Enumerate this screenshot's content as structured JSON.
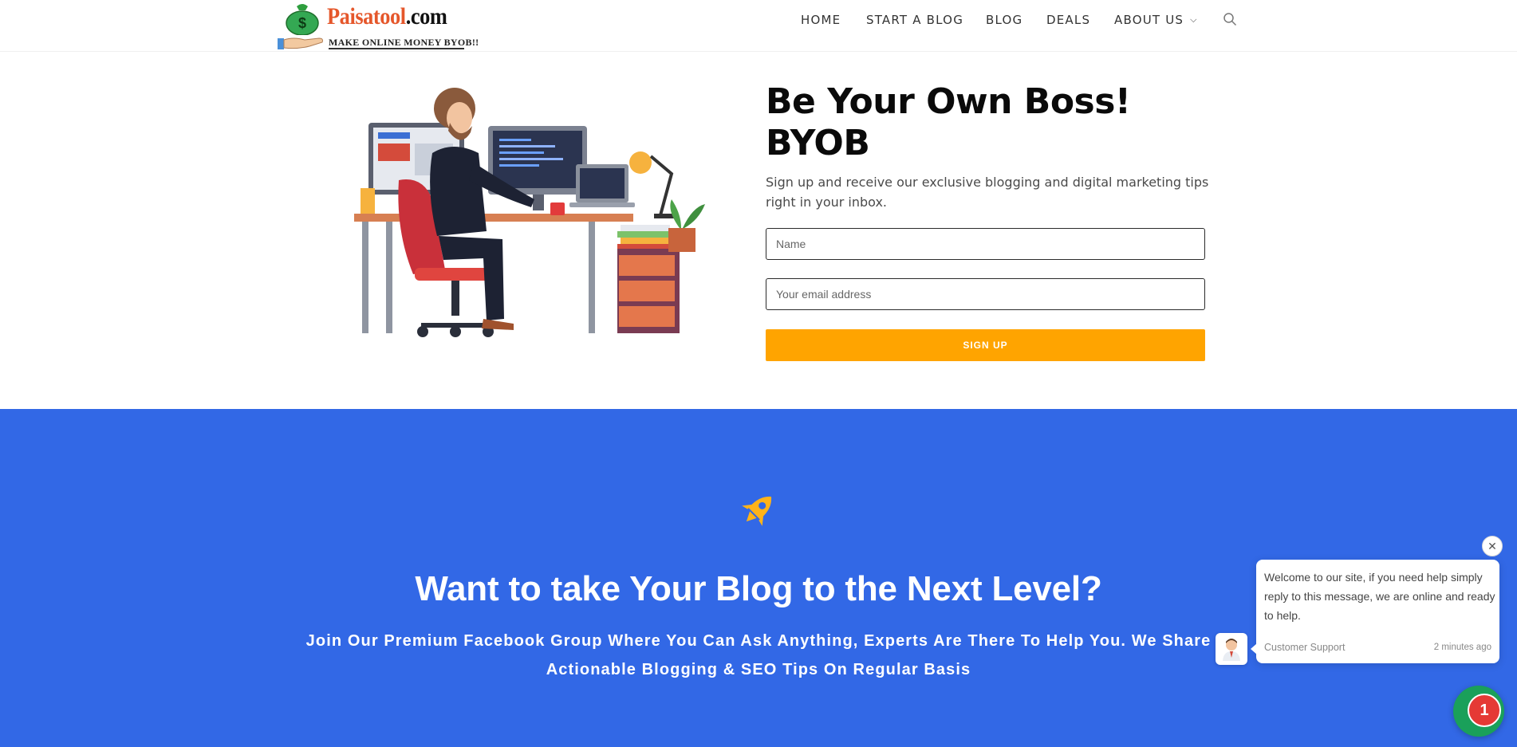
{
  "header": {
    "logo": {
      "brand_part1": "Paisatool",
      "brand_part2": ".com",
      "tagline": "MAKE ONLINE MONEY BYOB!!"
    },
    "nav": [
      {
        "label": "HOME"
      },
      {
        "label": "START A BLOG"
      },
      {
        "label": "BLOG"
      },
      {
        "label": "DEALS"
      },
      {
        "label": "ABOUT US"
      }
    ],
    "search_icon": "search-icon"
  },
  "hero": {
    "title_line1": "Be Your Own Boss!",
    "title_line2": "BYOB",
    "subtitle": "Sign up and receive our exclusive blogging and digital marketing tips right in your inbox.",
    "name_placeholder": "Name",
    "email_placeholder": "Your email address",
    "signup_label": "SIGN UP",
    "accent_color": "#ffa400"
  },
  "promo": {
    "icon": "rocket-icon",
    "title": "Want to take Your Blog to the Next Level?",
    "subtitle": "Join Our Premium Facebook Group Where You Can Ask Anything, Experts Are There To Help You. We Share Actionable Blogging & SEO Tips On Regular Basis",
    "background_color": "#3268e6"
  },
  "chat": {
    "message": "Welcome to our site, if you need help simply reply to this message, we are online and ready to help.",
    "from": "Customer Support",
    "time": "2 minutes ago",
    "close_symbol": "✕",
    "badge_count": "1",
    "launcher_color": "#1aa05a"
  }
}
